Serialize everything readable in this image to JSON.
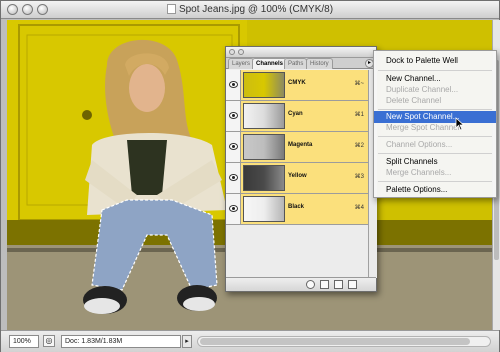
{
  "window": {
    "title": "Spot Jeans.jpg @ 100% (CMYK/8)"
  },
  "status": {
    "zoom": "100%",
    "doc_size": "Doc: 1.83M/1.83M"
  },
  "palette": {
    "tabs": [
      "Layers",
      "Channels",
      "Paths",
      "History"
    ],
    "active_tab": "Channels",
    "channels": [
      {
        "name": "CMYK",
        "shortcut": "⌘~"
      },
      {
        "name": "Cyan",
        "shortcut": "⌘1"
      },
      {
        "name": "Magenta",
        "shortcut": "⌘2"
      },
      {
        "name": "Yellow",
        "shortcut": "⌘3"
      },
      {
        "name": "Black",
        "shortcut": "⌘4"
      }
    ]
  },
  "menu": {
    "items": [
      {
        "label": "Dock to Palette Well",
        "state": "enabled"
      },
      {
        "label": "New Channel...",
        "state": "enabled"
      },
      {
        "label": "Duplicate Channel...",
        "state": "disabled"
      },
      {
        "label": "Delete Channel",
        "state": "disabled"
      },
      {
        "label": "New Spot Channel...",
        "state": "highlighted"
      },
      {
        "label": "Merge Spot Channel",
        "state": "disabled"
      },
      {
        "label": "Channel Options...",
        "state": "disabled"
      },
      {
        "label": "Split Channels",
        "state": "enabled"
      },
      {
        "label": "Merge Channels...",
        "state": "disabled"
      },
      {
        "label": "Palette Options...",
        "state": "enabled"
      }
    ]
  },
  "colors": {
    "highlight": "#3a6fd3",
    "channel_row": "#fbe07c",
    "wall_yellow": "#d8c400"
  }
}
